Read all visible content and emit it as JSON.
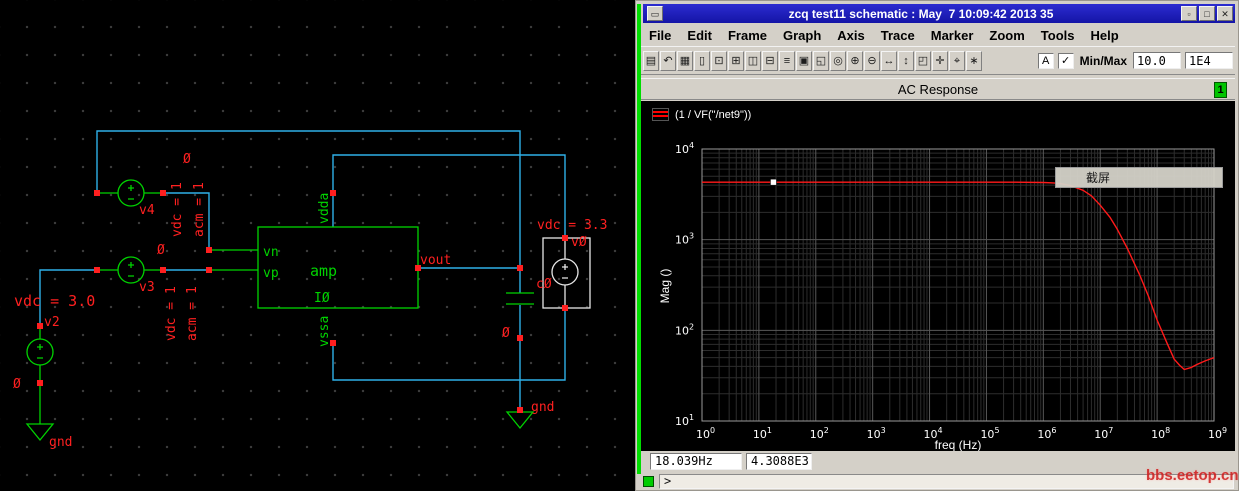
{
  "window": {
    "title": "zcq test11 schematic : May  7 10:09:42 2013 35",
    "controls": {
      "menu": "▭",
      "minimize": "▫",
      "maximize": "□",
      "close": "✕"
    },
    "menus": [
      "File",
      "Edit",
      "Frame",
      "Graph",
      "Axis",
      "Trace",
      "Marker",
      "Zoom",
      "Tools",
      "Help"
    ],
    "toolbar": {
      "icons": [
        {
          "name": "print-icon",
          "glyph": "▤"
        },
        {
          "name": "undo-icon",
          "glyph": "↶"
        },
        {
          "name": "grid-icon",
          "glyph": "▦"
        },
        {
          "name": "page-icon",
          "glyph": "▯"
        },
        {
          "name": "pages-icon",
          "glyph": "⊡"
        },
        {
          "name": "copy-window-icon",
          "glyph": "⊞"
        },
        {
          "name": "split-horizontal-icon",
          "glyph": "◫"
        },
        {
          "name": "split-vertical-icon",
          "glyph": "⊟"
        },
        {
          "name": "strip-chart-icon",
          "glyph": "≡"
        },
        {
          "name": "overlay-icon",
          "glyph": "▣"
        },
        {
          "name": "subwindow-icon",
          "glyph": "◱"
        },
        {
          "name": "smith-chart-icon",
          "glyph": "◎"
        },
        {
          "name": "zoom-in-icon",
          "glyph": "⊕"
        },
        {
          "name": "zoom-out-icon",
          "glyph": "⊖"
        },
        {
          "name": "zoom-x-icon",
          "glyph": "↔"
        },
        {
          "name": "zoom-y-icon",
          "glyph": "↕"
        },
        {
          "name": "zoom-fit-icon",
          "glyph": "◰"
        },
        {
          "name": "pan-icon",
          "glyph": "✛"
        },
        {
          "name": "crosshair-icon",
          "glyph": "⌖"
        },
        {
          "name": "point-marker-icon",
          "glyph": "∗"
        }
      ],
      "a_label": "A",
      "check_label": "✓",
      "minmax_label": "Min/Max",
      "min_value": "10.0",
      "max_value": "1E4"
    },
    "graph_number": "1",
    "status_x": "18.039Hz",
    "status_y": "4.3088E3",
    "prompt": ">"
  },
  "overlay": {
    "tooltip": "截屏"
  },
  "watermark": "bbs.eetop.cn",
  "schematic": {
    "labels": {
      "v2_value": "vdc = 3.0",
      "v2_name": "v2",
      "v2_zero": "Ø",
      "gnd_left": "gnd",
      "v4_name": "v4",
      "v3_name": "v3",
      "v4_vdc": "vdc = 1",
      "v4_acm": "acm = 1",
      "v3_vdc": "vdc = 1",
      "v3_acm": "acm = 1",
      "v4_zero": "Ø",
      "v3_zero": "Ø",
      "vn": "vn",
      "vp": "vp",
      "amp": "amp",
      "inst": "IØ",
      "vdda": "vdda",
      "vssa": "vssa",
      "vout": "vout",
      "cap_name": "cØ",
      "cap_zero": "Ø",
      "v0_value": "vdc = 3.3",
      "v0_name": "vØ",
      "gnd_right": "gnd"
    }
  },
  "chart_data": {
    "type": "line",
    "title": "AC Response",
    "xlabel": "freq (Hz)",
    "ylabel": "Mag ()",
    "x_scale": "log",
    "y_scale": "log",
    "xlim": [
      1,
      1000000000
    ],
    "ylim": [
      10,
      10000
    ],
    "grid": true,
    "legend_position": "top-left",
    "series": [
      {
        "name": "(1 / VF(\"/net9\"))",
        "color": "#ff1a1a",
        "x": [
          1,
          3,
          10,
          30,
          100,
          300,
          1000,
          3000,
          10000,
          30000,
          100000,
          300000,
          1000000,
          1500000,
          2000000,
          3000000,
          5000000,
          7000000,
          10000000,
          15000000,
          20000000,
          30000000,
          50000000,
          70000000,
          100000000,
          150000000,
          200000000,
          250000000,
          300000000,
          400000000,
          500000000,
          700000000,
          1000000000
        ],
        "y": [
          4308.8,
          4308.8,
          4308.8,
          4308.8,
          4308.8,
          4308.8,
          4308.8,
          4308.8,
          4308.8,
          4308.8,
          4307,
          4300,
          4270,
          4230,
          4150,
          3950,
          3500,
          3050,
          2400,
          1750,
          1300,
          800,
          400,
          240,
          130,
          72,
          48,
          41,
          37,
          39,
          42,
          46,
          50
        ]
      }
    ],
    "marker": {
      "x": 18.039,
      "y": 4308.8,
      "label_x": "18.039Hz",
      "label_y": "4.3088E3"
    }
  }
}
